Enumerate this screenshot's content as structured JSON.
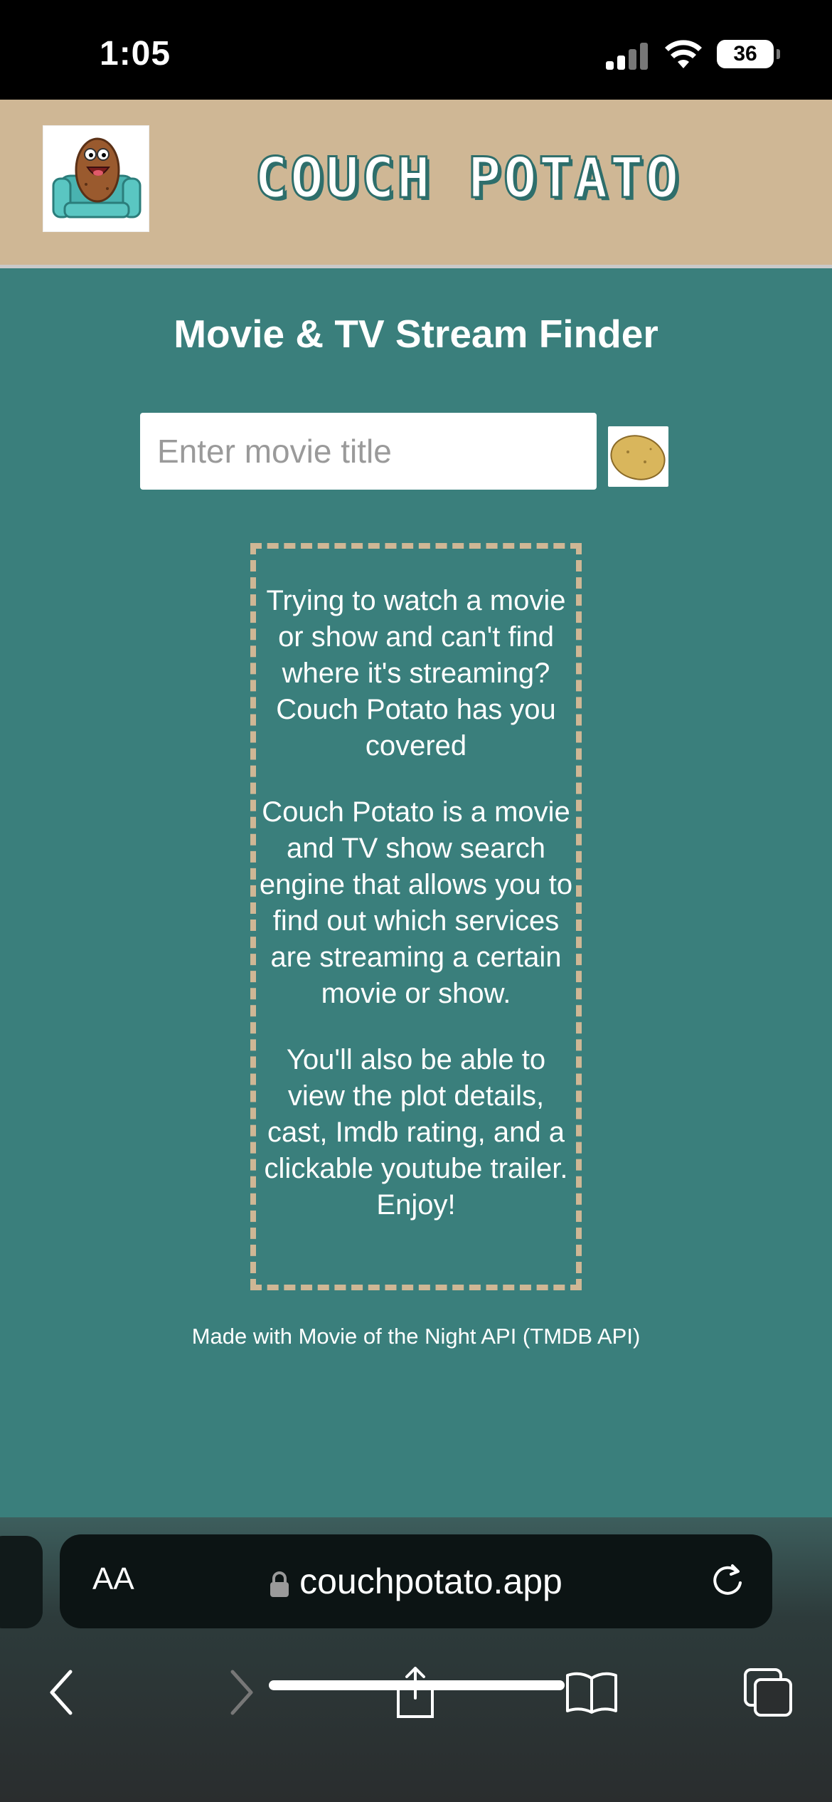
{
  "status_bar": {
    "time": "1:05",
    "battery": "36",
    "icons": [
      "signal-icon",
      "wifi-icon",
      "battery-icon"
    ]
  },
  "header": {
    "logo_icon": "couch-potato-logo",
    "brand": "COUCH POTATO"
  },
  "main": {
    "title": "Movie & TV Stream Finder",
    "search": {
      "placeholder": "Enter movie title",
      "value": "",
      "button_icon": "potato-icon"
    },
    "info_paragraphs": [
      "Trying to watch a movie or show and can't find where it's streaming? Couch Potato has you covered",
      "Couch Potato is a movie and TV show search engine that allows you to find out which services are streaming a certain movie or show.",
      "You'll also be able to view the plot details, cast, Imdb rating, and a clickable youtube trailer. Enjoy!"
    ],
    "credit": "Made with Movie of the Night API (TMDB API)"
  },
  "browser": {
    "aa_label": "AA",
    "url": "couchpotato.app",
    "toolbar_icons": [
      "back-icon",
      "forward-icon",
      "share-icon",
      "bookmarks-icon",
      "tabs-icon"
    ]
  },
  "colors": {
    "header_bg": "#cfb795",
    "main_bg": "#3a7f7c",
    "brand_outline": "#2e6e6b",
    "dashed_border": "#cfb795"
  }
}
